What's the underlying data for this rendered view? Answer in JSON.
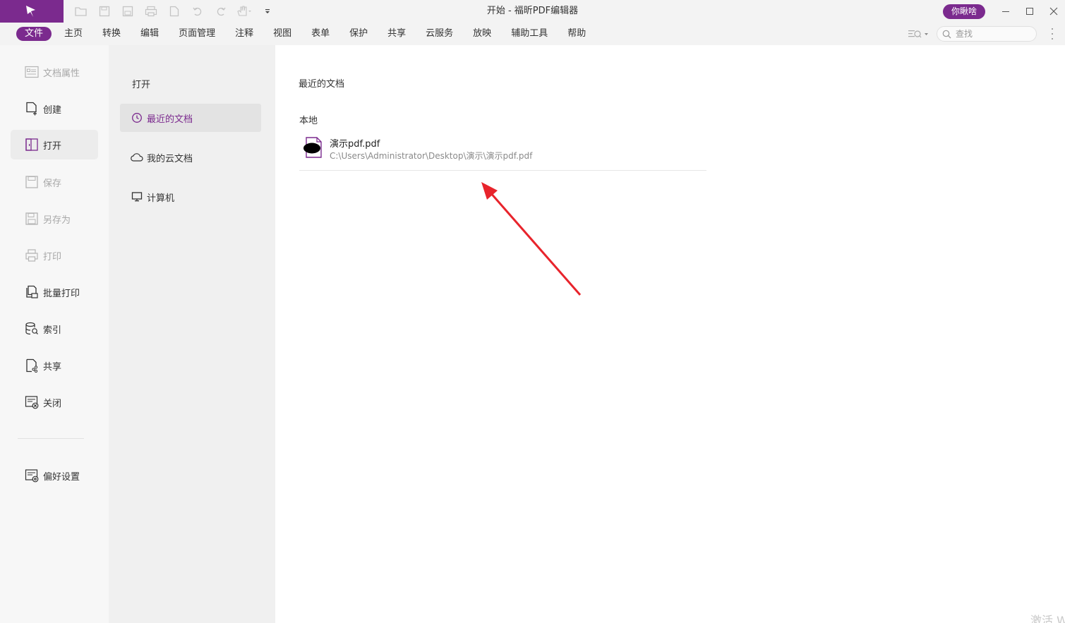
{
  "window": {
    "title": "开始 - 福昕PDF编辑器",
    "user_button": "你瞅啥"
  },
  "quick_access": [
    {
      "icon": "open-folder-icon"
    },
    {
      "icon": "save-icon"
    },
    {
      "icon": "save-as-icon"
    },
    {
      "icon": "print-icon"
    },
    {
      "icon": "new-doc-icon"
    },
    {
      "icon": "undo-icon"
    },
    {
      "icon": "redo-icon"
    },
    {
      "icon": "hand-tool-icon"
    },
    {
      "icon": "customize-dropdown-icon"
    }
  ],
  "menus": [
    "文件",
    "主页",
    "转换",
    "编辑",
    "页面管理",
    "注释",
    "视图",
    "表单",
    "保护",
    "共享",
    "云服务",
    "放映",
    "辅助工具",
    "帮助"
  ],
  "active_menu": "文件",
  "search": {
    "placeholder": "查找"
  },
  "left_nav": {
    "items": [
      {
        "label": "文档属性",
        "icon": "document-properties-icon",
        "state": "disabled"
      },
      {
        "label": "创建",
        "icon": "create-icon",
        "state": "normal"
      },
      {
        "label": "打开",
        "icon": "open-icon",
        "state": "active"
      },
      {
        "label": "保存",
        "icon": "save-icon",
        "state": "disabled"
      },
      {
        "label": "另存为",
        "icon": "save-as-icon",
        "state": "disabled"
      },
      {
        "label": "打印",
        "icon": "print-icon",
        "state": "disabled"
      },
      {
        "label": "批量打印",
        "icon": "batch-print-icon",
        "state": "normal"
      },
      {
        "label": "索引",
        "icon": "index-icon",
        "state": "normal"
      },
      {
        "label": "共享",
        "icon": "share-icon",
        "state": "normal"
      },
      {
        "label": "关闭",
        "icon": "close-doc-icon",
        "state": "normal"
      }
    ],
    "preferences": {
      "label": "偏好设置",
      "icon": "preferences-icon"
    }
  },
  "open_pane": {
    "title": "打开",
    "items": [
      {
        "label": "最近的文档",
        "icon": "clock-icon",
        "active": true
      },
      {
        "label": "我的云文档",
        "icon": "cloud-icon",
        "active": false
      },
      {
        "label": "计算机",
        "icon": "computer-icon",
        "active": false
      }
    ]
  },
  "recent": {
    "title": "最近的文档",
    "section": "本地",
    "files": [
      {
        "name": "演示pdf.pdf",
        "path": "C:\\Users\\Administrator\\Desktop\\演示\\演示pdf.pdf"
      }
    ]
  },
  "watermark": "激活 W",
  "colors": {
    "accent": "#7b2a8e",
    "annotation_arrow": "#e8242c"
  }
}
